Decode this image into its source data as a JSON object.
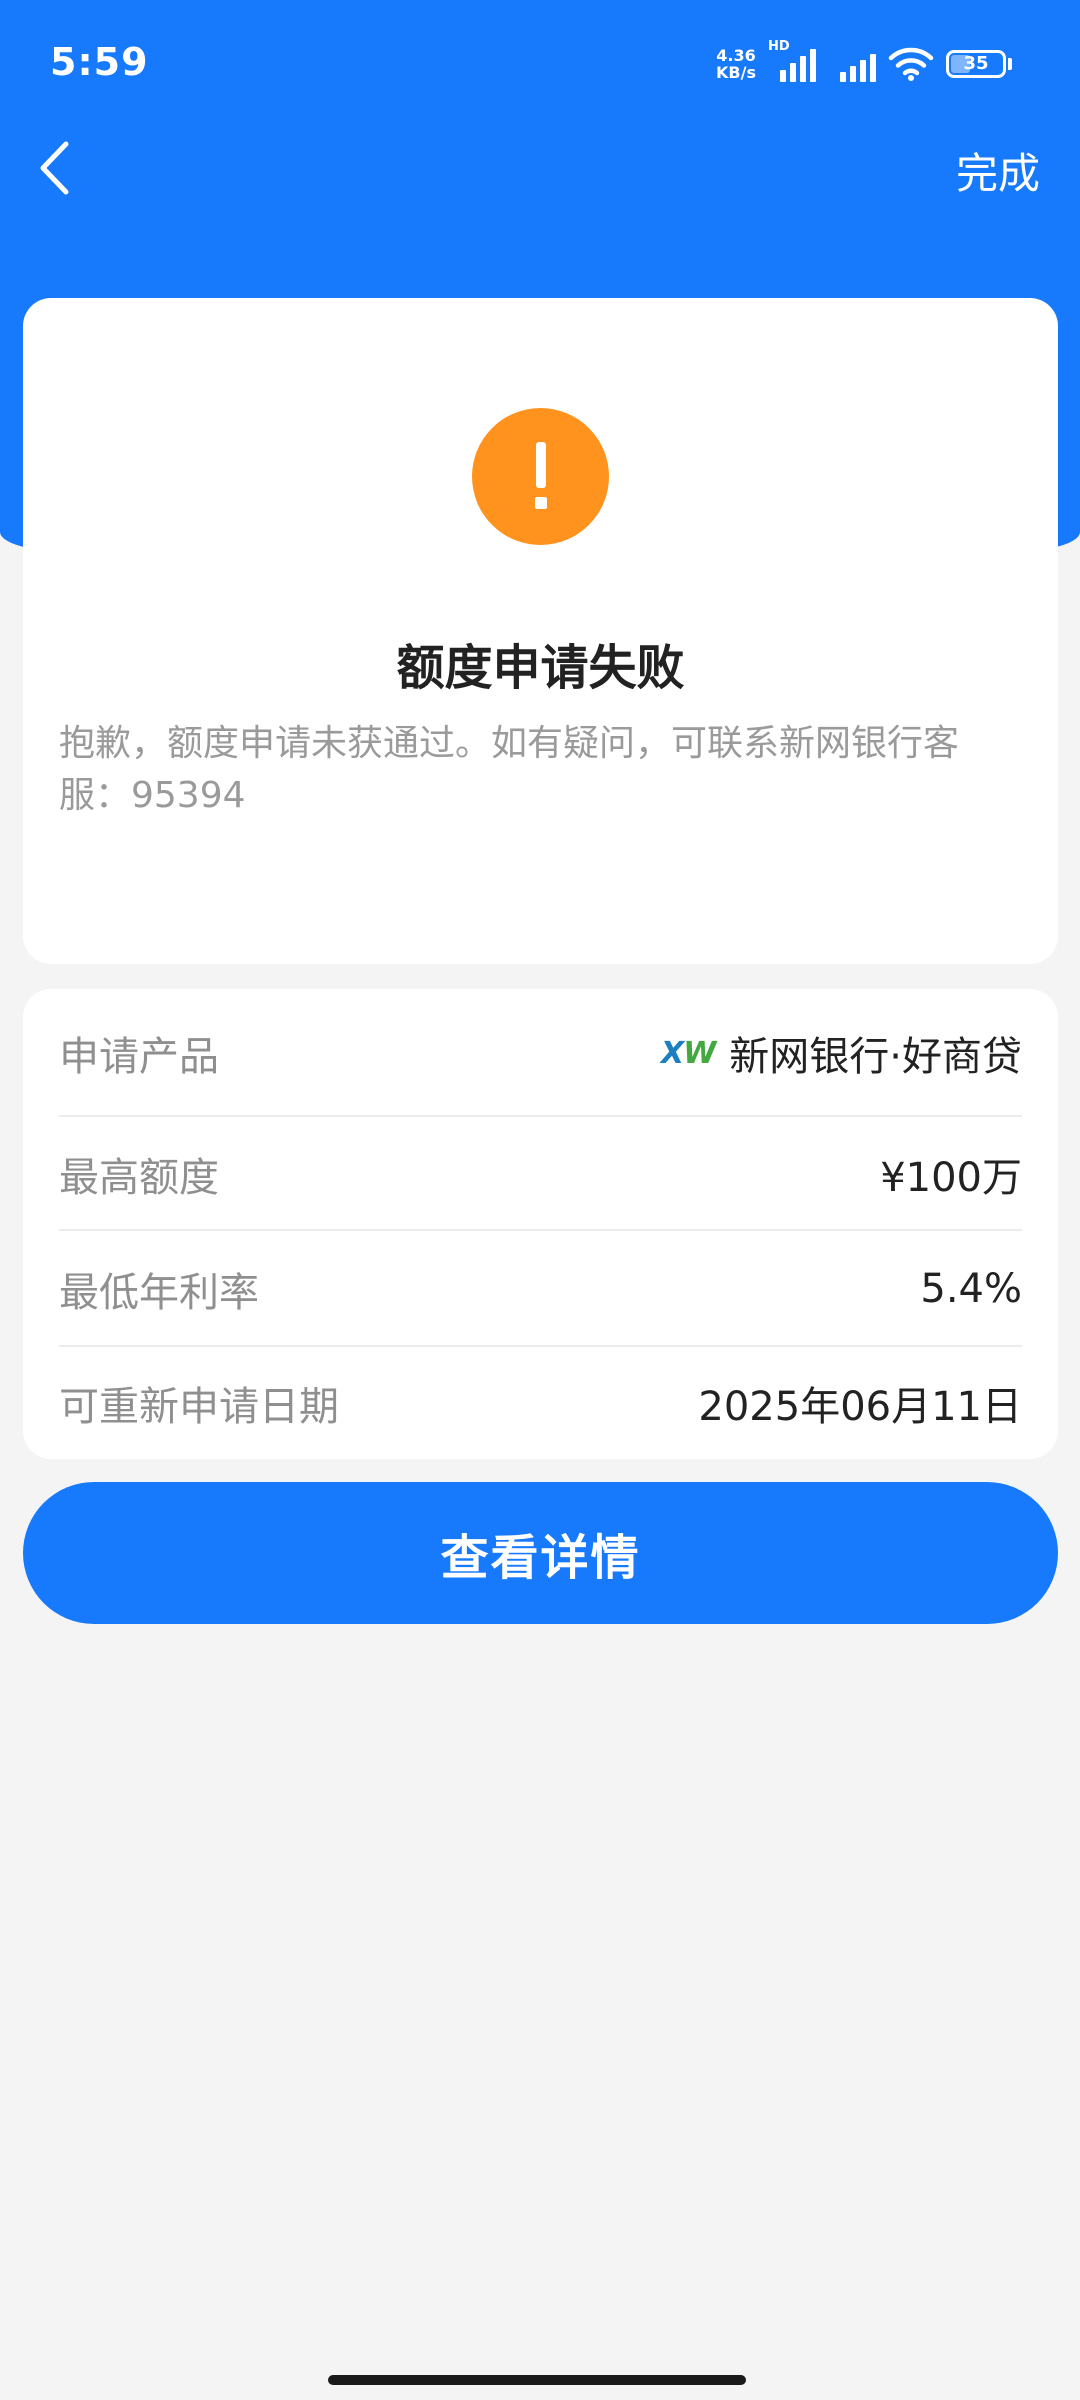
{
  "status_bar": {
    "time": "5:59",
    "net_speed_value": "4.36",
    "net_speed_unit": "KB/s",
    "hd_label": "HD",
    "battery_level": "35"
  },
  "nav": {
    "done_label": "完成",
    "back_icon": "chevron-left-icon"
  },
  "result": {
    "icon": "exclamation-icon",
    "title": "额度申请失败",
    "description": "抱歉，额度申请未获通过。如有疑问，可联系新网银行客服：95394"
  },
  "info": {
    "product": {
      "label": "申请产品",
      "logo_x": "X",
      "logo_w": "W",
      "value": "新网银行·好商贷"
    },
    "max_amount": {
      "label": "最高额度",
      "value": "¥100万"
    },
    "min_rate": {
      "label": "最低年利率",
      "value": "5.4%"
    },
    "reapply_date": {
      "label": "可重新申请日期",
      "value": "2025年06月11日"
    }
  },
  "actions": {
    "details_label": "查看详情"
  },
  "colors": {
    "primary": "#1779fb",
    "warning": "#ff931e",
    "background": "#f4f4f4"
  }
}
